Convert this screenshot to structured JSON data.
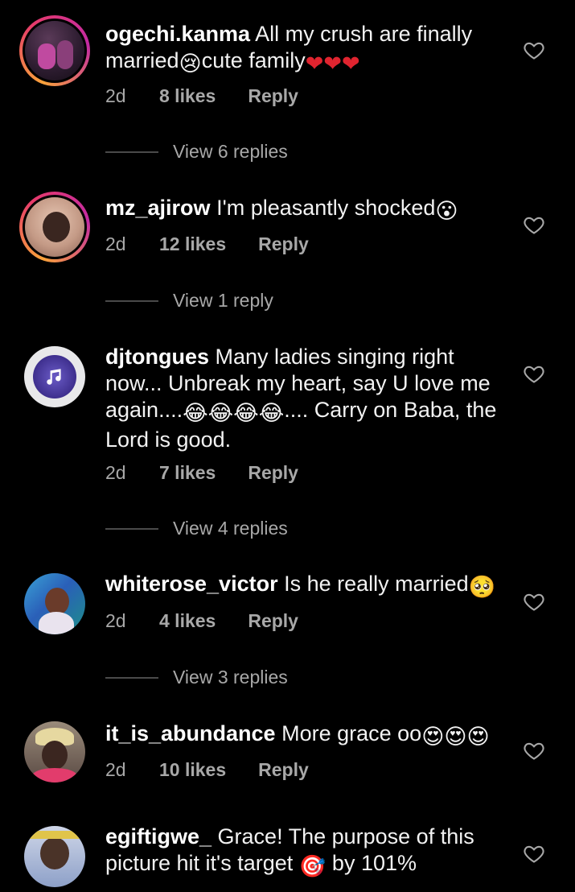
{
  "comments": [
    {
      "username": "ogechi.kanma",
      "text": "All my crush are finally married",
      "text_after": "cute family",
      "emojis_mid": "😢",
      "emojis_end": "❤❤❤",
      "time": "2d",
      "likes": "8 likes",
      "reply": "Reply",
      "view_replies": "View 6 replies",
      "avatar_icon": "profile-photo"
    },
    {
      "username": "mz_ajirow",
      "text": "I'm pleasantly shocked",
      "emojis_end": "😮",
      "time": "2d",
      "likes": "12 likes",
      "reply": "Reply",
      "view_replies": "View 1 reply",
      "avatar_icon": "profile-photo"
    },
    {
      "username": "djtongues",
      "text": "Many ladies singing right now... Unbreak my heart, say U love me again....",
      "emojis_mid": "😂😂😂😂",
      "text_after": ".... Carry on Baba, the Lord is good.",
      "time": "2d",
      "likes": "7 likes",
      "reply": "Reply",
      "view_replies": "View 4 replies",
      "avatar_icon": "music-note-logo"
    },
    {
      "username": "whiterose_victor",
      "text": "Is he really married",
      "emojis_end": "🥺",
      "time": "2d",
      "likes": "4 likes",
      "reply": "Reply",
      "view_replies": "View 3 replies",
      "avatar_icon": "profile-photo"
    },
    {
      "username": "it_is_abundance",
      "text": "More grace oo",
      "emojis_end": "😍😍😍",
      "time": "2d",
      "likes": "10 likes",
      "reply": "Reply",
      "avatar_icon": "profile-photo"
    },
    {
      "username": "egiftigwe_",
      "text": "Grace!  The purpose of this picture hit it's target",
      "emojis_mid": "🎯",
      "text_after": "by 101%",
      "avatar_icon": "profile-photo"
    }
  ],
  "colors": {
    "background": "#000000",
    "meta_text": "#a8a8a8",
    "story_ring_start": "#f9a23a",
    "story_ring_end": "#c32aa3"
  }
}
